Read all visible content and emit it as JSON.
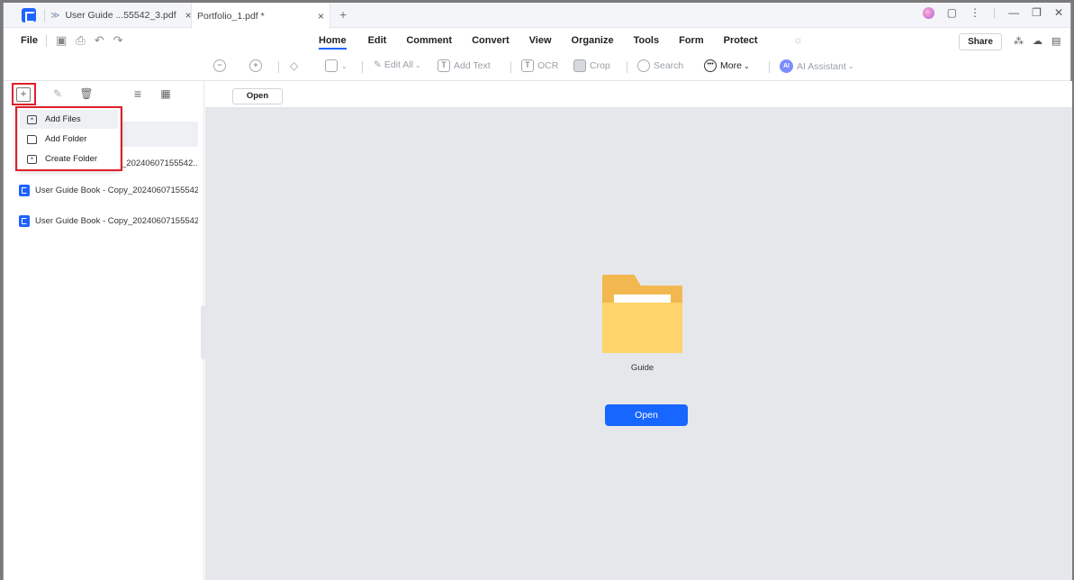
{
  "titlebar": {
    "tabs": [
      {
        "label": "User Guide ...55542_3.pdf",
        "active": false
      },
      {
        "label": "Portfolio_1.pdf *",
        "active": true
      }
    ],
    "new_tab": "+",
    "close_glyph": "×"
  },
  "menubar": {
    "file": "File",
    "items": [
      "Home",
      "Edit",
      "Comment",
      "Convert",
      "View",
      "Organize",
      "Tools",
      "Form",
      "Protect"
    ],
    "active_item": "Home",
    "share": "Share"
  },
  "toolbar": {
    "edit_all": "Edit All",
    "add_text": "Add Text",
    "ocr": "OCR",
    "crop": "Crop",
    "search": "Search",
    "more": "More",
    "ai_badge": "AI",
    "ai_assistant": "AI Assistant"
  },
  "sidebar": {
    "dropdown": {
      "items": [
        "Add Files",
        "Add Folder",
        "Create Folder"
      ]
    },
    "files": [
      "_20240607155542...",
      "User Guide Book - Copy_20240607155542...",
      "User Guide Book - Copy_20240607155542..."
    ]
  },
  "main": {
    "open_small": "Open",
    "folder_name": "Guide",
    "open_button": "Open"
  },
  "colors": {
    "accent": "#1f63ff",
    "highlight": "#e0202a",
    "folder": "#ffd46b"
  }
}
